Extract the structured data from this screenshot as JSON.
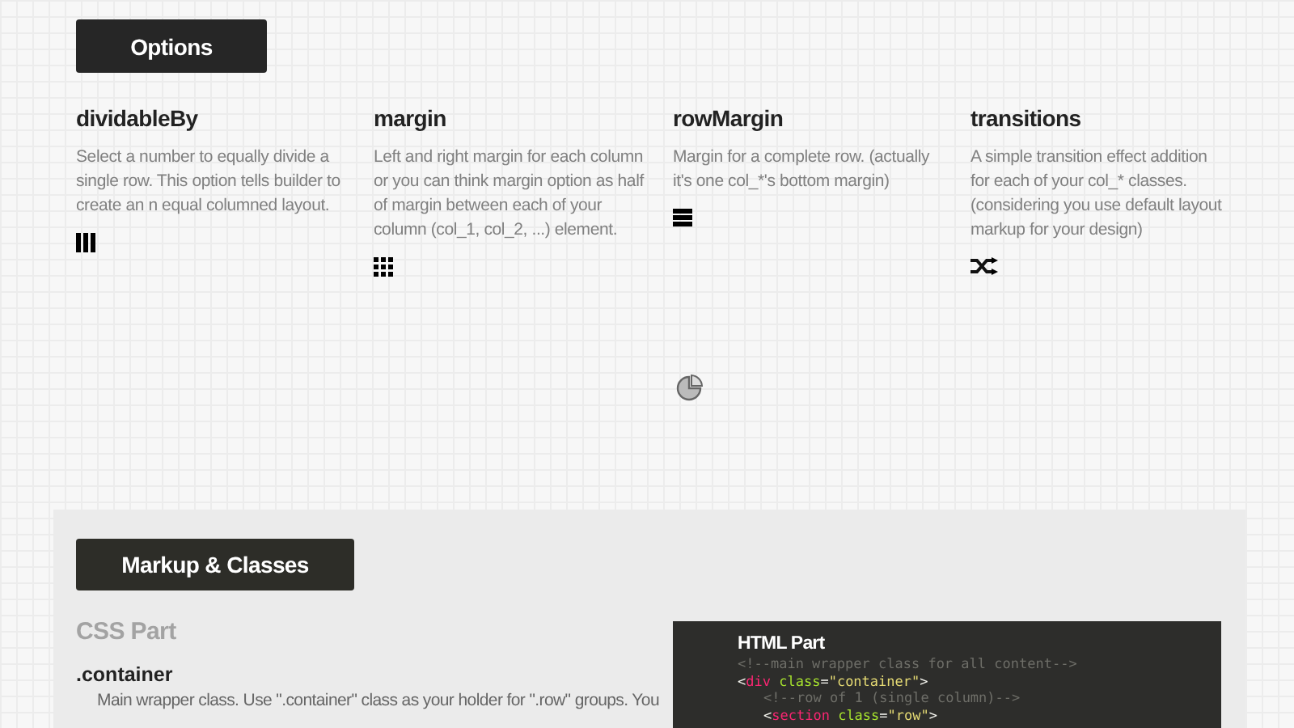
{
  "options_button": "Options",
  "options": [
    {
      "title": "dividableBy",
      "description": "Select a number to equally divide a single row. This option tells builder to create an n equal columned layout.",
      "kind": "columns"
    },
    {
      "title": "margin",
      "description": "Left and right margin for each column or you can think margin option as half of margin between each of your column (col_1, col_2, ...) element.",
      "kind": "grid"
    },
    {
      "title": "rowMargin",
      "description": "Margin for a complete row. (actually it's one col_*'s bottom margin)",
      "kind": "rows"
    },
    {
      "title": "transitions",
      "description": "A simple transition effect addition for each of your col_* classes. (considering you use default layout markup for your design)",
      "kind": "shuffle"
    }
  ],
  "markup_button": "Markup & Classes",
  "css_part": {
    "heading": "CSS Part",
    "class_name": ".container",
    "description": "Main wrapper class. Use \".container\" class as your holder for \".row\" groups. You"
  },
  "html_part": {
    "heading": "HTML Part",
    "lines": [
      {
        "tokens": [
          {
            "kind": "comment",
            "text": "<!--main wrapper class for all content-->"
          }
        ]
      },
      {
        "tokens": [
          {
            "kind": "punct",
            "text": "<"
          },
          {
            "kind": "tag",
            "text": "div"
          },
          {
            "kind": "attr",
            "text": " class"
          },
          {
            "kind": "punct",
            "text": "="
          },
          {
            "kind": "string",
            "text": "\"container\""
          },
          {
            "kind": "punct",
            "text": ">"
          }
        ],
        "children": [
          {
            "tokens": [
              {
                "kind": "comment",
                "text": "<!--row of 1 (single column)-->"
              }
            ]
          },
          {
            "tokens": [
              {
                "kind": "punct",
                "text": "<"
              },
              {
                "kind": "tag",
                "text": "section"
              },
              {
                "kind": "attr",
                "text": " class"
              },
              {
                "kind": "punct",
                "text": "="
              },
              {
                "kind": "string",
                "text": "\"row\""
              },
              {
                "kind": "punct",
                "text": ">"
              }
            ]
          }
        ]
      }
    ]
  }
}
